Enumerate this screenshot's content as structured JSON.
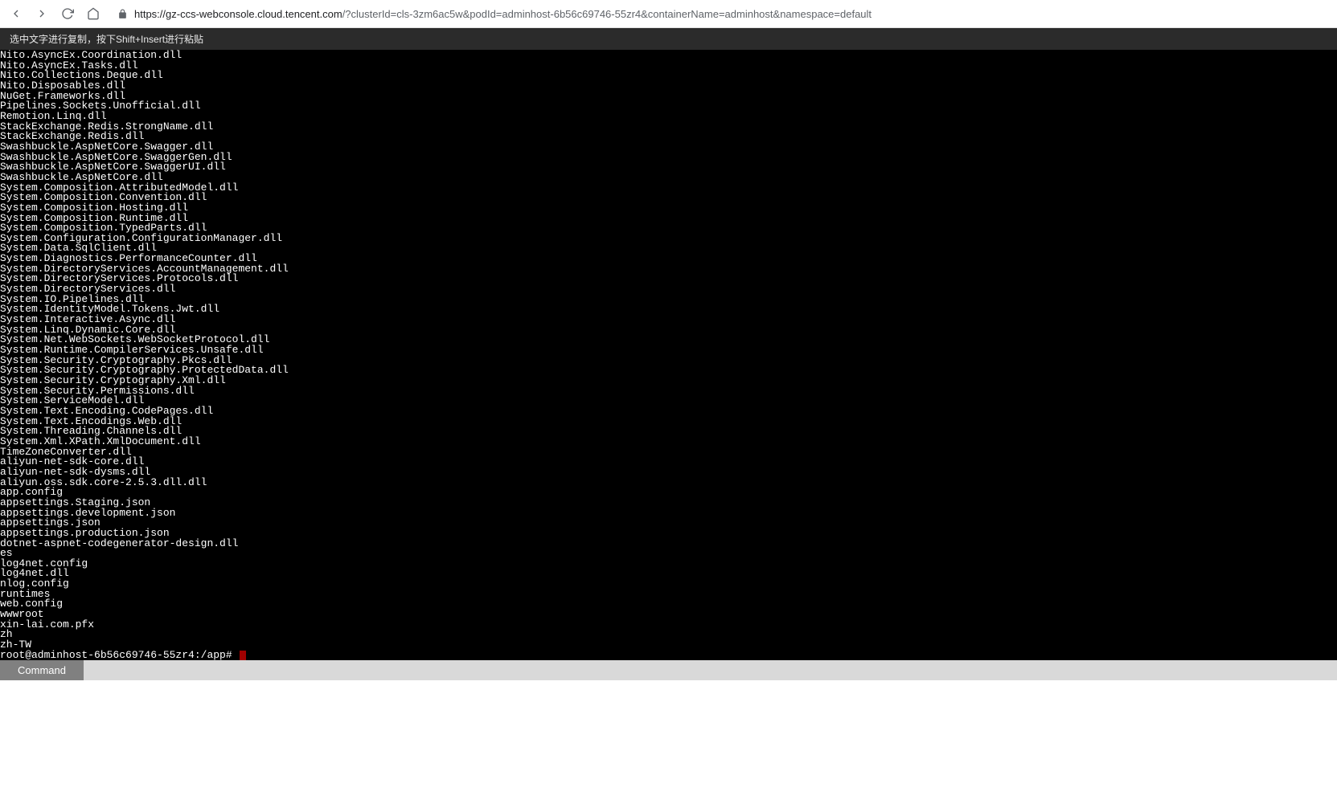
{
  "browser": {
    "url_host": "https://gz-ccs-webconsole.cloud.tencent.com",
    "url_path": "/?clusterId=cls-3zm6ac5w&podId=adminhost-6b56c69746-55zr4&containerName=adminhost&namespace=default"
  },
  "instruction_text": "选中文字进行复制，按下Shift+Insert进行粘贴",
  "terminal_lines": [
    "Nito.AsyncEx.Coordination.dll",
    "Nito.AsyncEx.Tasks.dll",
    "Nito.Collections.Deque.dll",
    "Nito.Disposables.dll",
    "NuGet.Frameworks.dll",
    "Pipelines.Sockets.Unofficial.dll",
    "Remotion.Linq.dll",
    "StackExchange.Redis.StrongName.dll",
    "StackExchange.Redis.dll",
    "Swashbuckle.AspNetCore.Swagger.dll",
    "Swashbuckle.AspNetCore.SwaggerGen.dll",
    "Swashbuckle.AspNetCore.SwaggerUI.dll",
    "Swashbuckle.AspNetCore.dll",
    "System.Composition.AttributedModel.dll",
    "System.Composition.Convention.dll",
    "System.Composition.Hosting.dll",
    "System.Composition.Runtime.dll",
    "System.Composition.TypedParts.dll",
    "System.Configuration.ConfigurationManager.dll",
    "System.Data.SqlClient.dll",
    "System.Diagnostics.PerformanceCounter.dll",
    "System.DirectoryServices.AccountManagement.dll",
    "System.DirectoryServices.Protocols.dll",
    "System.DirectoryServices.dll",
    "System.IO.Pipelines.dll",
    "System.IdentityModel.Tokens.Jwt.dll",
    "System.Interactive.Async.dll",
    "System.Linq.Dynamic.Core.dll",
    "System.Net.WebSockets.WebSocketProtocol.dll",
    "System.Runtime.CompilerServices.Unsafe.dll",
    "System.Security.Cryptography.Pkcs.dll",
    "System.Security.Cryptography.ProtectedData.dll",
    "System.Security.Cryptography.Xml.dll",
    "System.Security.Permissions.dll",
    "System.ServiceModel.dll",
    "System.Text.Encoding.CodePages.dll",
    "System.Text.Encodings.Web.dll",
    "System.Threading.Channels.dll",
    "System.Xml.XPath.XmlDocument.dll",
    "TimeZoneConverter.dll",
    "aliyun-net-sdk-core.dll",
    "aliyun-net-sdk-dysms.dll",
    "aliyun.oss.sdk.core-2.5.3.dll.dll",
    "app.config",
    "appsettings.Staging.json",
    "appsettings.development.json",
    "appsettings.json",
    "appsettings.production.json",
    "dotnet-aspnet-codegenerator-design.dll",
    "es",
    "log4net.config",
    "log4net.dll",
    "nlog.config",
    "runtimes",
    "web.config",
    "wwwroot",
    "xin-lai.com.pfx",
    "zh",
    "zh-TW"
  ],
  "prompt_text": "root@adminhost-6b56c69746-55zr4:/app# ",
  "footer": {
    "command_label": "Command"
  }
}
